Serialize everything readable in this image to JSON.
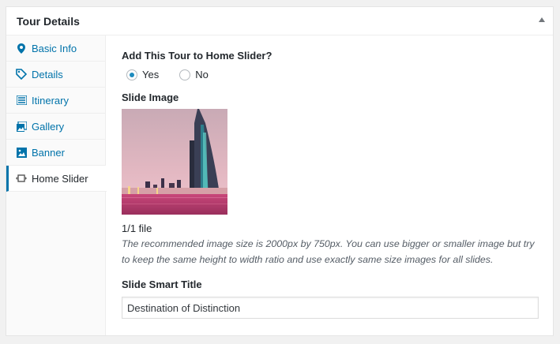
{
  "metabox": {
    "title": "Tour Details"
  },
  "tabs": [
    {
      "label": "Basic Info",
      "icon": "location-pin-icon"
    },
    {
      "label": "Details",
      "icon": "tag-icon"
    },
    {
      "label": "Itinerary",
      "icon": "list-icon"
    },
    {
      "label": "Gallery",
      "icon": "images-icon"
    },
    {
      "label": "Banner",
      "icon": "image-icon"
    },
    {
      "label": "Home Slider",
      "icon": "slider-icon",
      "active": true
    }
  ],
  "panel": {
    "slider_question": "Add This Tour to Home Slider?",
    "options": [
      {
        "label": "Yes",
        "checked": true
      },
      {
        "label": "No",
        "checked": false
      }
    ],
    "slide_image_label": "Slide Image",
    "file_count": "1/1 file",
    "description": "The recommended image size is 2000px by 750px. You can use bigger or smaller image but try to keep the same height to width ratio and use exactly same size images for all slides.",
    "smart_title_label": "Slide Smart Title",
    "smart_title_value": "Destination of Distinction"
  },
  "colors": {
    "accent": "#0073aa",
    "radio_checked": "#1e8cbe"
  }
}
